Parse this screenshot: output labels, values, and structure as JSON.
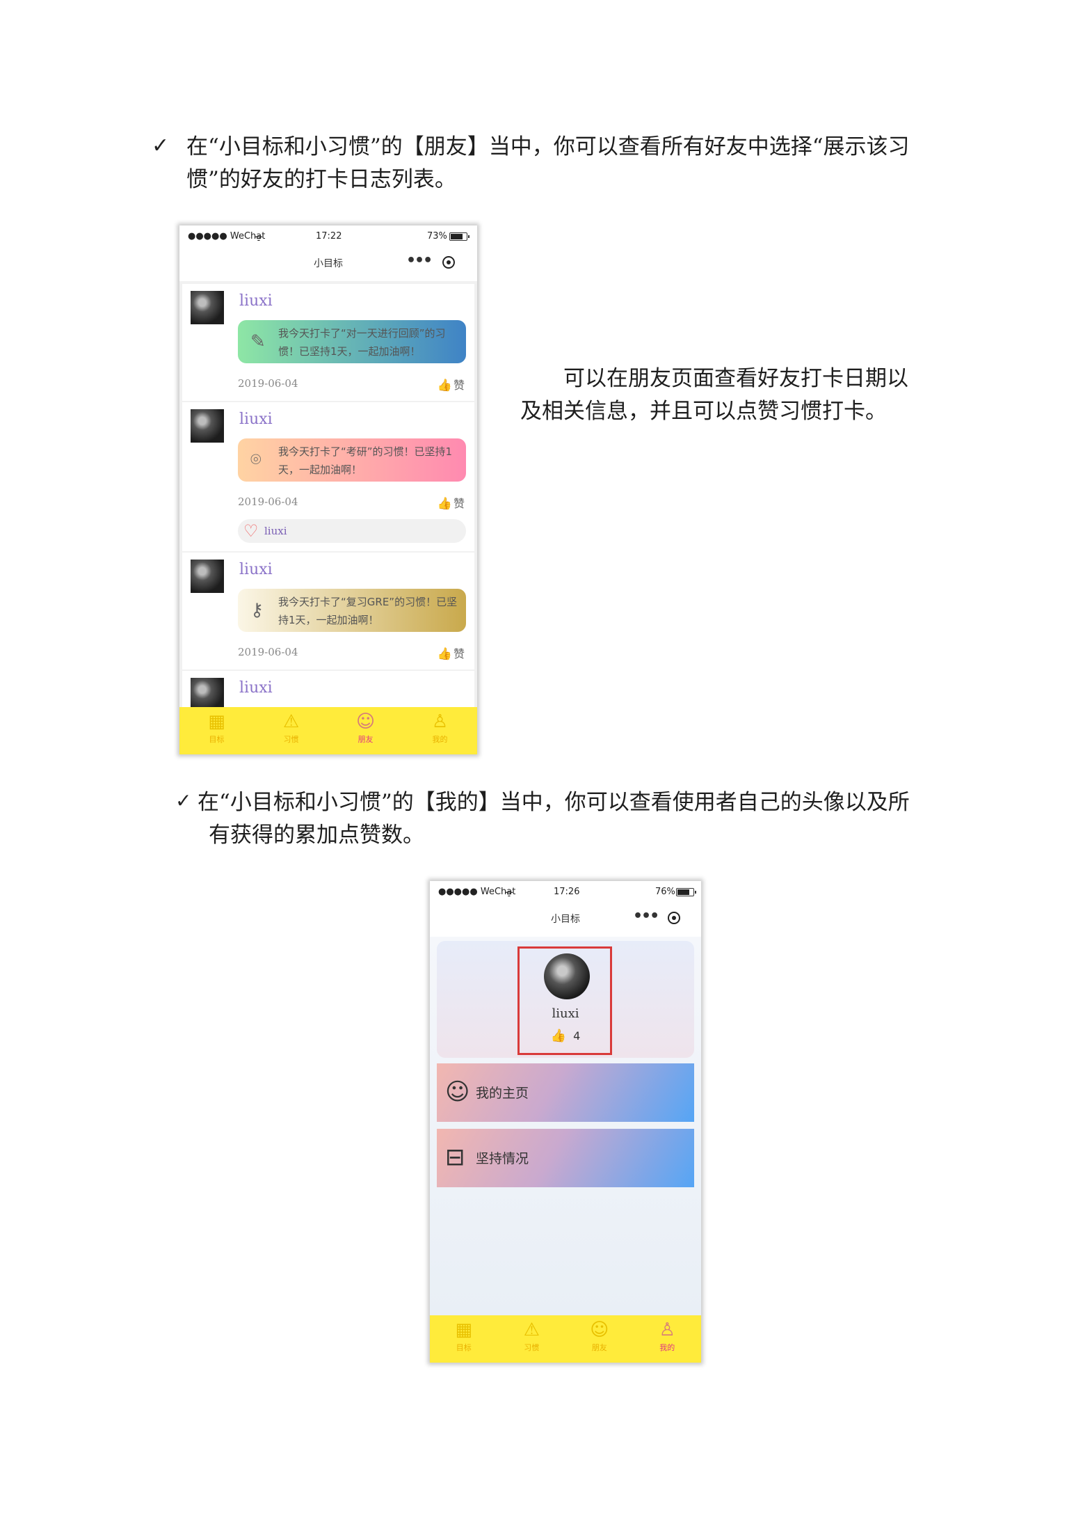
{
  "section1": {
    "check": "✓",
    "line1": "在“小目标和小习惯”的【朋友】当中，你可以查看所有好友中选择“展示该习",
    "line2": "惯”的好友的打卡日志列表。"
  },
  "side_text": {
    "line1": "可以在朋友页面查看好友打卡日期以",
    "line2": "及相关信息，并且可以点赞习惯打卡。"
  },
  "section2": {
    "check": "✓",
    "line1": "在“小目标和小习惯”的【我的】当中，你可以查看使用者自己的头像以及所",
    "line2": "有获得的累加点赞数。"
  },
  "phone1": {
    "status": {
      "carrier": "●●●●● WeChat",
      "wifi": "ᯤ",
      "time": "17:22",
      "battery": "73%"
    },
    "nav_title": "小目标",
    "posts": [
      {
        "user": "liuxi",
        "text": "我今天打卡了“对一天进行回顾”的习惯！已坚持1天，一起加油啊！",
        "date": "2019-06-04",
        "like_label": "赞",
        "icon": "pencil-icon",
        "color_from": "#8ee6a5",
        "color_to": "#3f83c6"
      },
      {
        "user": "liuxi",
        "text": "我今天打卡了“考研”的习惯！已坚持1天，一起加油啊！",
        "date": "2019-06-04",
        "like_label": "赞",
        "liked_by": "liuxi",
        "icon": "location-icon",
        "color_from": "#ffd3a3",
        "color_to": "#ff8ab0"
      },
      {
        "user": "liuxi",
        "text": "我今天打卡了“复习GRE”的习惯！已坚持1天，一起加油啊！",
        "date": "2019-06-04",
        "like_label": "赞",
        "icon": "key-icon",
        "color_from": "#fbf6e6",
        "color_to": "#c9a94c"
      },
      {
        "user": "liuxi"
      }
    ],
    "tabs": [
      {
        "label": "目标",
        "icon": "goal-icon"
      },
      {
        "label": "习惯",
        "icon": "habit-icon"
      },
      {
        "label": "朋友",
        "icon": "friends-icon"
      },
      {
        "label": "我的",
        "icon": "me-icon"
      }
    ],
    "active_tab": "朋友"
  },
  "phone2": {
    "status": {
      "carrier": "●●●●● WeChat",
      "wifi": "ᯤ",
      "time": "17:26",
      "battery": "76%"
    },
    "nav_title": "小目标",
    "profile": {
      "name": "liuxi",
      "likes": "4"
    },
    "menu": [
      {
        "label": "我的主页",
        "icon": "user-icon"
      },
      {
        "label": "坚持情况",
        "icon": "dumbbell-icon"
      }
    ],
    "tabs": [
      {
        "label": "目标",
        "icon": "goal-icon"
      },
      {
        "label": "习惯",
        "icon": "habit-icon"
      },
      {
        "label": "朋友",
        "icon": "friends-icon"
      },
      {
        "label": "我的",
        "icon": "me-icon"
      }
    ],
    "active_tab": "我的"
  }
}
